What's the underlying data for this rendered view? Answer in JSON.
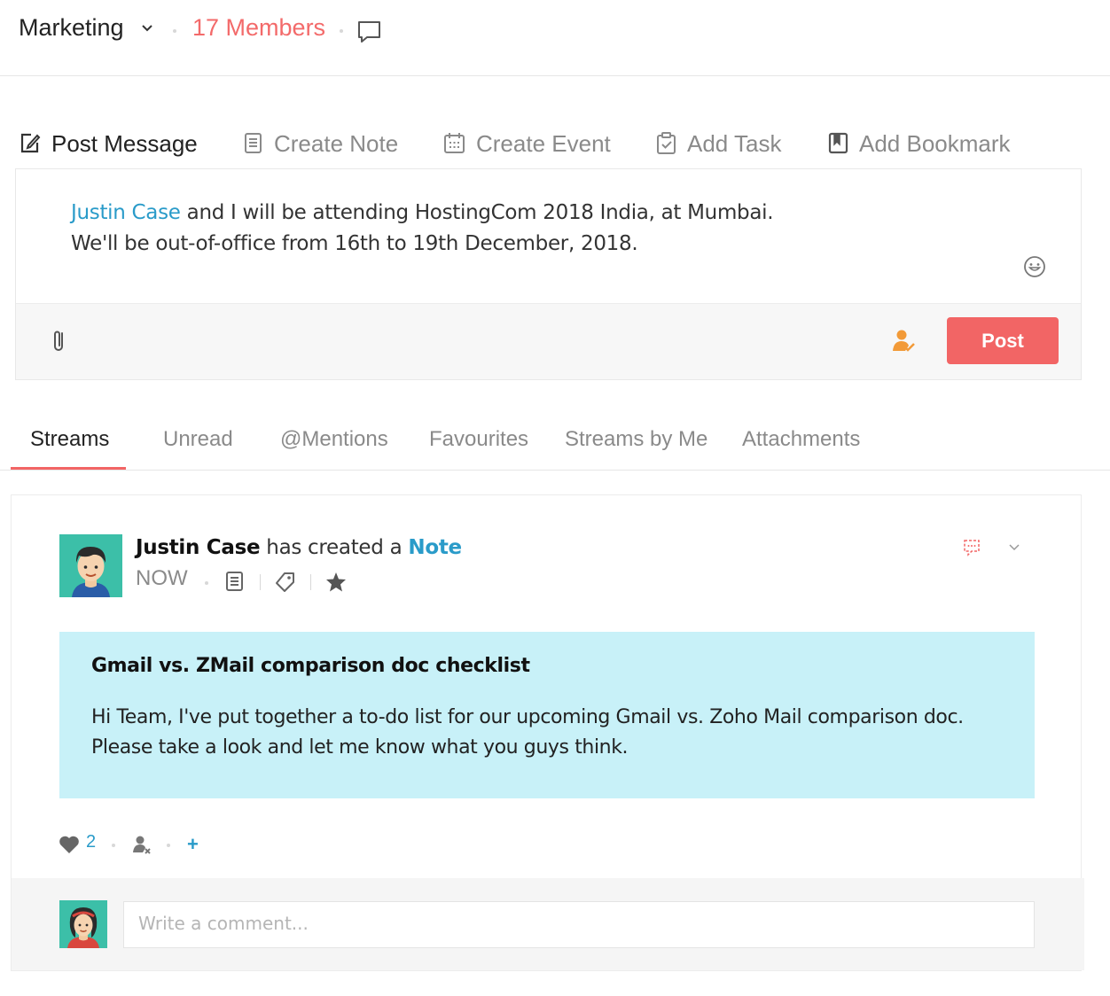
{
  "header": {
    "group_name": "Marketing",
    "members_label": "17 Members"
  },
  "composer": {
    "tabs": [
      {
        "label": "Post Message",
        "icon": "edit-icon",
        "active": true
      },
      {
        "label": "Create Note",
        "icon": "note-icon",
        "active": false
      },
      {
        "label": "Create Event",
        "icon": "calendar-icon",
        "active": false
      },
      {
        "label": "Add Task",
        "icon": "task-icon",
        "active": false
      },
      {
        "label": "Add Bookmark",
        "icon": "bookmark-icon",
        "active": false
      }
    ],
    "message": {
      "mention": "Justin Case",
      "line1_rest": " and I will be attending HostingCom 2018 India, at Mumbai.",
      "line2": "We'll be out-of-office from 16th to 19th December, 2018."
    },
    "post_label": "Post"
  },
  "stream_tabs": [
    {
      "label": "Streams",
      "active": true
    },
    {
      "label": "Unread",
      "active": false
    },
    {
      "label": "@Mentions",
      "active": false
    },
    {
      "label": "Favourites",
      "active": false
    },
    {
      "label": "Streams by Me",
      "active": false
    },
    {
      "label": "Attachments",
      "active": false
    }
  ],
  "stream_item": {
    "author": "Justin Case",
    "action_text": " has created a ",
    "object_type": "Note",
    "time": "NOW",
    "note": {
      "title": "Gmail vs. ZMail comparison doc checklist",
      "body_line1": "Hi Team, I've put together a to-do list for our upcoming Gmail vs. Zoho Mail comparison doc.",
      "body_line2": "Please take a look and let me know what you guys think."
    },
    "like_count": "2",
    "add_label": "+",
    "comment_placeholder": "Write a comment..."
  },
  "colors": {
    "accent_red": "#f26565",
    "members_red": "#f36a6a",
    "link_blue": "#2a9bc9",
    "note_bg": "#c8f1f8",
    "avatar_teal": "#3cbfa8"
  }
}
